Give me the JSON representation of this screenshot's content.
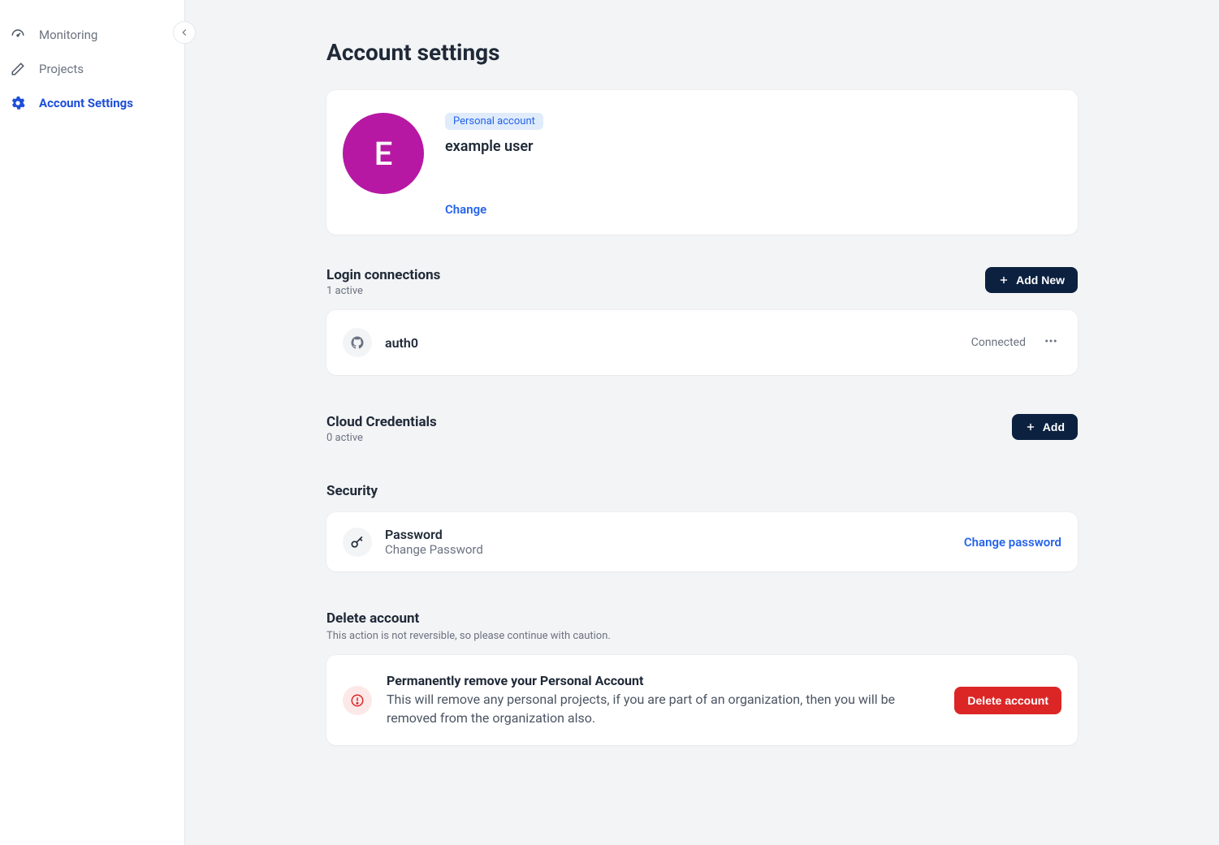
{
  "sidebar": {
    "items": [
      {
        "label": "Monitoring",
        "icon": "gauge"
      },
      {
        "label": "Projects",
        "icon": "pencil"
      },
      {
        "label": "Account Settings",
        "icon": "gear",
        "active": true
      }
    ]
  },
  "page": {
    "title": "Account settings"
  },
  "profile": {
    "badge": "Personal account",
    "avatar_letter": "E",
    "name": "example user",
    "change_label": "Change"
  },
  "login_connections": {
    "title": "Login connections",
    "active_text": "1 active",
    "add_button": "Add New",
    "items": [
      {
        "name": "auth0",
        "status": "Connected",
        "icon": "github"
      }
    ]
  },
  "cloud_credentials": {
    "title": "Cloud Credentials",
    "active_text": "0 active",
    "add_button": "Add"
  },
  "security": {
    "title": "Security",
    "password_title": "Password",
    "password_sub": "Change Password",
    "change_password": "Change password"
  },
  "delete": {
    "title": "Delete account",
    "caution": "This action is not reversible, so please continue with caution.",
    "warn_title": "Permanently remove your Personal Account",
    "warn_desc": "This will remove any personal projects, if you are part of an organization, then you will be removed from the organization also.",
    "button": "Delete account"
  }
}
